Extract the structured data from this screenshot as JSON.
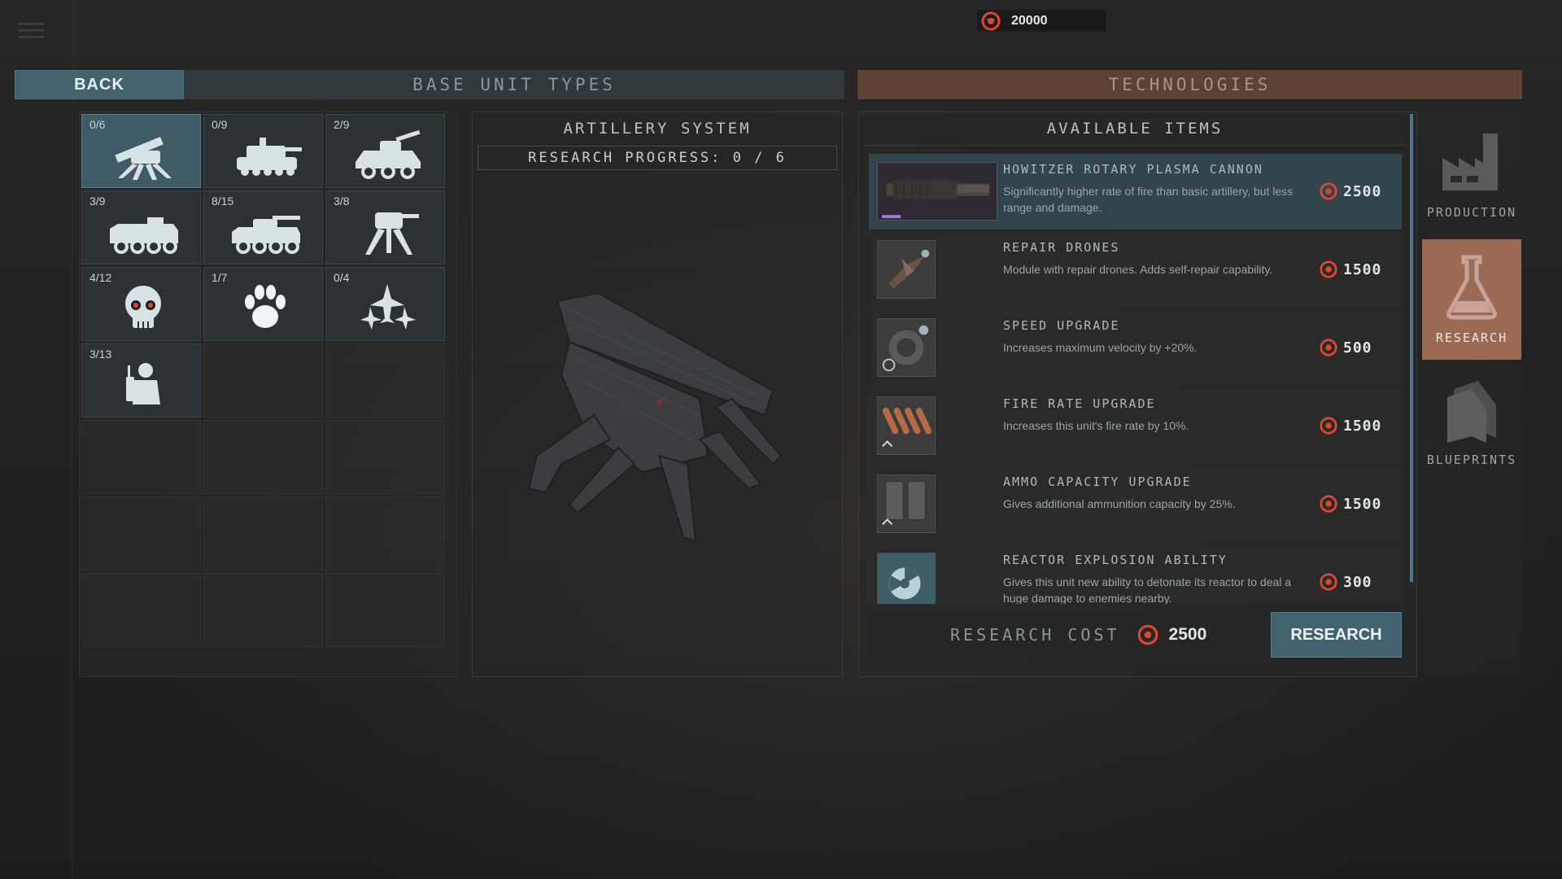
{
  "header": {
    "credits": "20000",
    "back_label": "BACK",
    "base_units_label": "BASE UNIT TYPES",
    "technologies_label": "TECHNOLOGIES"
  },
  "units": [
    {
      "count": "0/6",
      "icon": "artillery-walker-icon"
    },
    {
      "count": "0/9",
      "icon": "heavy-tank-icon"
    },
    {
      "count": "2/9",
      "icon": "armored-car-icon"
    },
    {
      "count": "3/9",
      "icon": "apc-icon"
    },
    {
      "count": "8/15",
      "icon": "tank-8wheel-icon"
    },
    {
      "count": "3/8",
      "icon": "walker-mech-icon"
    },
    {
      "count": "4/12",
      "icon": "skull-icon"
    },
    {
      "count": "1/7",
      "icon": "paw-icon"
    },
    {
      "count": "0/4",
      "icon": "jets-icon"
    },
    {
      "count": "3/13",
      "icon": "soldier-icon"
    }
  ],
  "center": {
    "title": "ARTILLERY SYSTEM",
    "progress_label": "RESEARCH PROGRESS: 0 / 6"
  },
  "tech": {
    "title": "AVAILABLE ITEMS",
    "items": [
      {
        "name": "HOWITZER ROTARY PLASMA CANNON",
        "desc": "Significantly higher rate of fire than basic artillery, but less range and damage.",
        "cost": "2500",
        "icon": "plasma-cannon-icon"
      },
      {
        "name": "REPAIR DRONES",
        "desc": "Module with repair drones. Adds self-repair capability.",
        "cost": "1500",
        "icon": "repair-drone-icon"
      },
      {
        "name": "SPEED UPGRADE",
        "desc": "Increases maximum velocity by +20%.",
        "cost": "500",
        "icon": "speed-upgrade-icon"
      },
      {
        "name": "FIRE RATE UPGRADE",
        "desc": "Increases this unit's fire rate by 10%.",
        "cost": "1500",
        "icon": "bullets-icon"
      },
      {
        "name": "AMMO CAPACITY UPGRADE",
        "desc": "Gives additional ammunition capacity by 25%.",
        "cost": "1500",
        "icon": "ammo-icon"
      },
      {
        "name": "REACTOR EXPLOSION ABILITY",
        "desc": "Gives this unit new ability to detonate its reactor to deal a huge damage to enemies nearby.",
        "cost": "300",
        "icon": "reactor-icon"
      }
    ],
    "research_cost_label": "RESEARCH COST",
    "research_cost_value": "2500",
    "research_button": "RESEARCH"
  },
  "side_tabs": [
    {
      "label": "PRODUCTION",
      "icon": "factory-icon",
      "active": false
    },
    {
      "label": "RESEARCH",
      "icon": "flask-icon",
      "active": true
    },
    {
      "label": "BLUEPRINTS",
      "icon": "blueprints-icon",
      "active": false
    }
  ],
  "colors": {
    "accent_blue": "#43626d",
    "accent_orange": "#9a6a54",
    "credit_red": "#e0452e"
  }
}
